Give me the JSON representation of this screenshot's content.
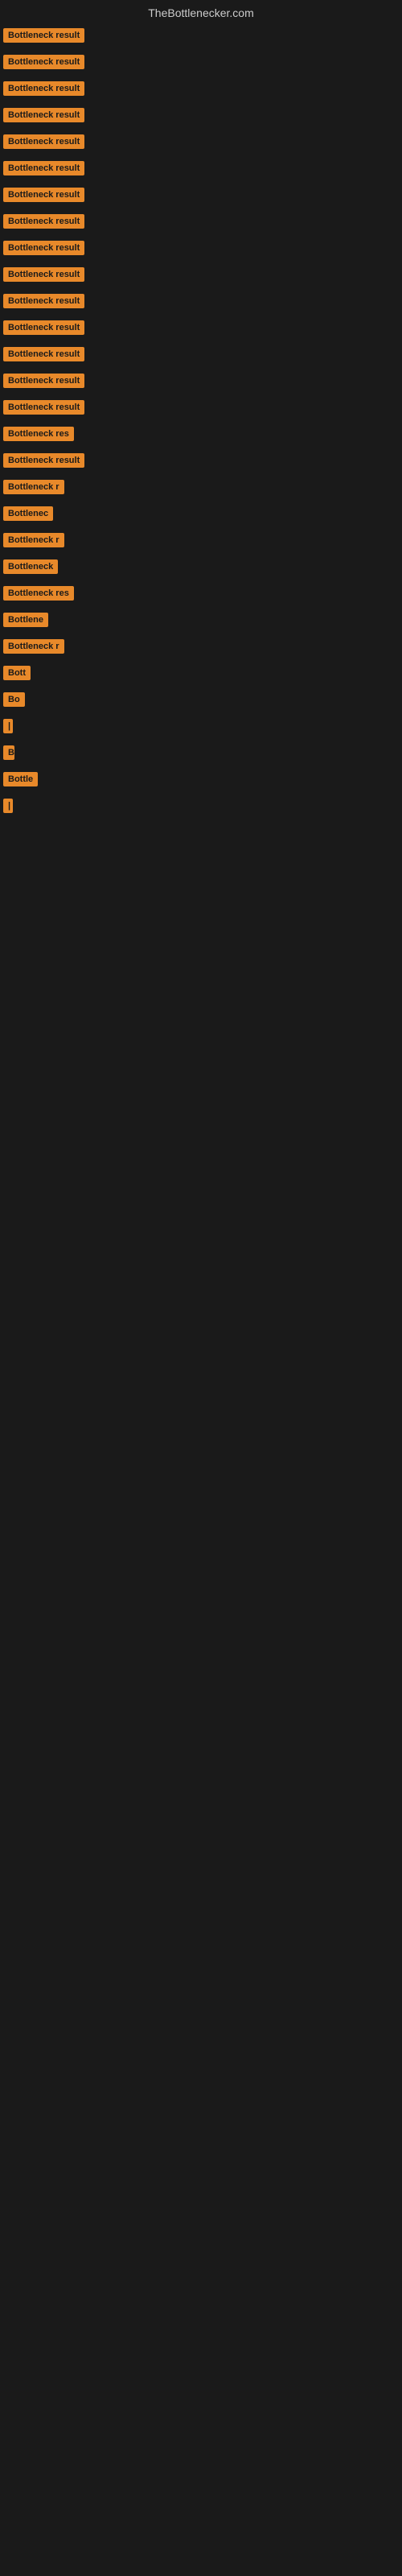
{
  "header": {
    "title": "TheBottlenecker.com"
  },
  "items": [
    {
      "label": "Bottleneck result",
      "width": 130
    },
    {
      "label": "Bottleneck result",
      "width": 130
    },
    {
      "label": "Bottleneck result",
      "width": 130
    },
    {
      "label": "Bottleneck result",
      "width": 130
    },
    {
      "label": "Bottleneck result",
      "width": 130
    },
    {
      "label": "Bottleneck result",
      "width": 130
    },
    {
      "label": "Bottleneck result",
      "width": 130
    },
    {
      "label": "Bottleneck result",
      "width": 130
    },
    {
      "label": "Bottleneck result",
      "width": 130
    },
    {
      "label": "Bottleneck result",
      "width": 130
    },
    {
      "label": "Bottleneck result",
      "width": 130
    },
    {
      "label": "Bottleneck result",
      "width": 125
    },
    {
      "label": "Bottleneck result",
      "width": 120
    },
    {
      "label": "Bottleneck result",
      "width": 118
    },
    {
      "label": "Bottleneck result",
      "width": 115
    },
    {
      "label": "Bottleneck res",
      "width": 100
    },
    {
      "label": "Bottleneck result",
      "width": 115
    },
    {
      "label": "Bottleneck r",
      "width": 90
    },
    {
      "label": "Bottlenec",
      "width": 78
    },
    {
      "label": "Bottleneck r",
      "width": 90
    },
    {
      "label": "Bottleneck",
      "width": 80
    },
    {
      "label": "Bottleneck res",
      "width": 100
    },
    {
      "label": "Bottlene",
      "width": 72
    },
    {
      "label": "Bottleneck r",
      "width": 88
    },
    {
      "label": "Bott",
      "width": 42
    },
    {
      "label": "Bo",
      "width": 28
    },
    {
      "label": "|",
      "width": 8
    },
    {
      "label": "B",
      "width": 14
    },
    {
      "label": "Bottle",
      "width": 50
    },
    {
      "label": "|",
      "width": 8
    }
  ]
}
